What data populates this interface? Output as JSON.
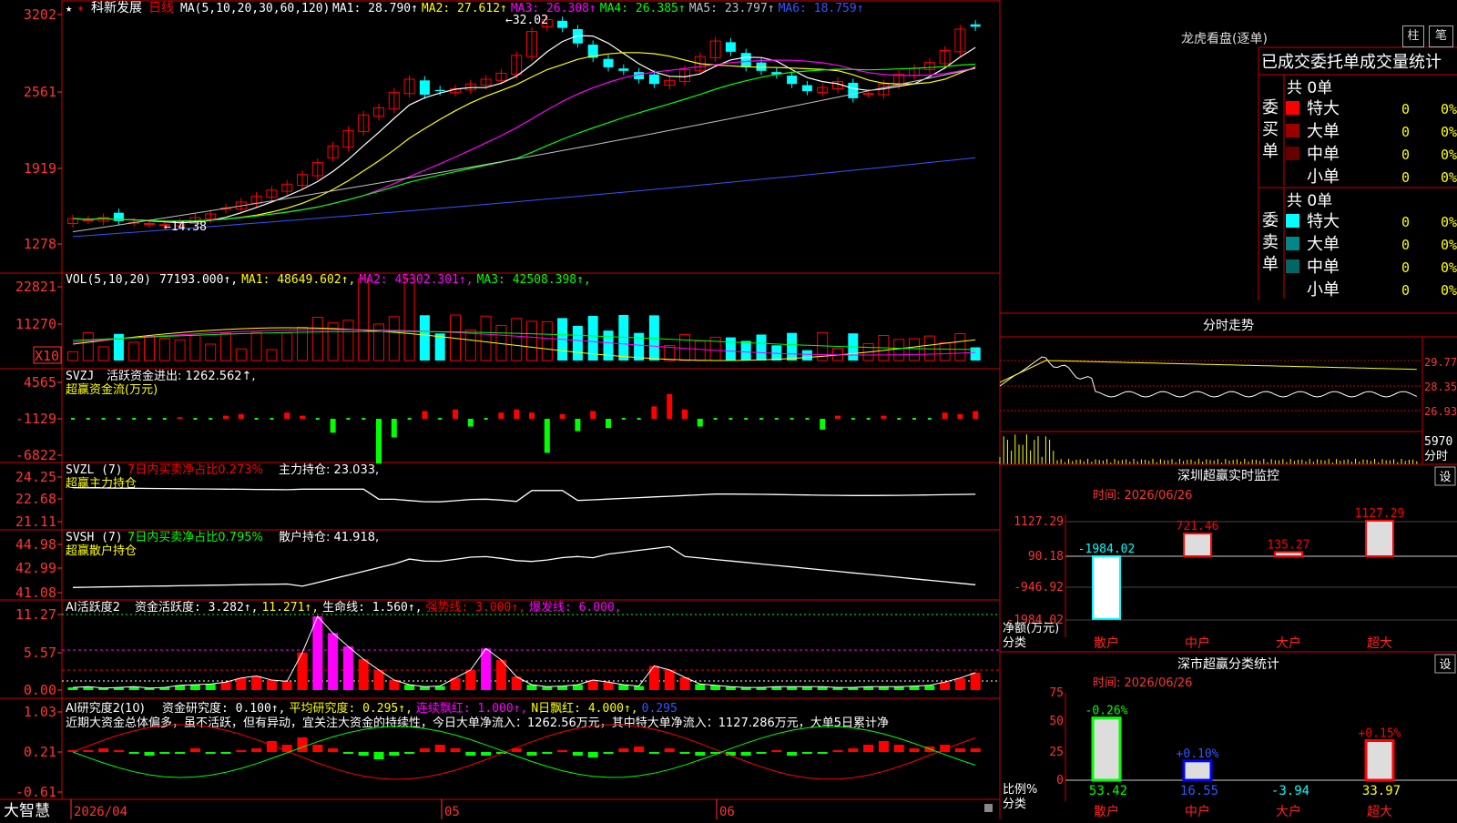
{
  "app": {
    "logo": "大智慧"
  },
  "main_chart": {
    "stock_name": "科新发展",
    "period": "日线",
    "ma_header": "MA(5,10,20,30,60,120)",
    "ma_labels": [
      {
        "text": "MA1: 28.790",
        "color": "#ffffff"
      },
      {
        "text": "MA2: 27.612",
        "color": "#ffff00"
      },
      {
        "text": "MA3: 26.308",
        "color": "#ff00ff"
      },
      {
        "text": "MA4: 26.385",
        "color": "#00ff00"
      },
      {
        "text": "MA5: 23.797",
        "color": "#c0c0c0"
      },
      {
        "text": "MA6: 18.759",
        "color": "#3355ff"
      }
    ],
    "y_ticks": [
      "3202",
      "2561",
      "1919",
      "1278"
    ],
    "high_label": "32.02",
    "low_label": "14.38"
  },
  "volume_panel": {
    "header": "VOL(5,10,20)",
    "value": "77193.000",
    "ma_labels": [
      {
        "text": "MA1: 48649.602",
        "color": "#ffff00"
      },
      {
        "text": "MA2: 45302.301",
        "color": "#ff00ff"
      },
      {
        "text": "MA3: 42508.398",
        "color": "#00ff00"
      }
    ],
    "y_ticks": [
      "22821",
      "11270"
    ],
    "unit": "X10"
  },
  "svzj_panel": {
    "header": "SVZJ",
    "label": "活跃资金进出: 1262.562",
    "sub_label": "超赢资金流(万元)",
    "y_ticks": [
      "4565",
      "-1129",
      "-6822"
    ]
  },
  "svzl_panel": {
    "header": "SVZL (7)",
    "ratio_label": "7日内买卖净占比0.273%",
    "holding_label": "主力持仓: 23.033",
    "sub_label": "超赢主力持仓",
    "y_ticks": [
      "24.25",
      "22.68",
      "21.11"
    ]
  },
  "svsh_panel": {
    "header": "SVSH (7)",
    "ratio_label": "7日内买卖净占比0.795%",
    "holding_label": "散户持仓: 41.918",
    "sub_label": "超赢散户持仓",
    "y_ticks": [
      "44.98",
      "42.99",
      "41.08"
    ]
  },
  "ai_active_panel": {
    "header": "AI活跃度2",
    "items": [
      {
        "text": "资金活跃度: 3.282",
        "color": "#ffffff"
      },
      {
        "text": "11.271",
        "color": "#ffff00"
      },
      {
        "text": "生命线: 1.560",
        "color": "#ffffff"
      },
      {
        "text": "强势线: 3.000",
        "color": "#ff0000"
      },
      {
        "text": "爆发线: 6.000",
        "color": "#ff00ff"
      }
    ],
    "y_ticks": [
      "11.27",
      "5.57",
      "0.00"
    ]
  },
  "ai_research_panel": {
    "header": "AI研究度2(10)",
    "items": [
      {
        "text": "资金研究度: 0.100",
        "color": "#ffffff"
      },
      {
        "text": "平均研究度: 0.295",
        "color": "#ffff00"
      },
      {
        "text": "连续飘红: 1.000",
        "color": "#ff00ff"
      },
      {
        "text": "N日飘红: 4.000",
        "color": "#ffff00"
      },
      {
        "text": "0.295",
        "color": "#3355ff"
      }
    ],
    "commentary": "近期大资金总体偏多，虽不活跃，但有异动，宜关注大资金的持续性，今日大单净流入：1262.56万元，其中特大单净流入：1127.286万元，大单5日累计净",
    "y_ticks": [
      "1.03",
      "0.21",
      "-0.61"
    ]
  },
  "x_axis": {
    "labels": [
      "2026/04",
      "05",
      "06"
    ]
  },
  "dragon_panel": {
    "title": "龙虎看盘(逐单)",
    "btn_bar": "柱",
    "btn_pen": "笔",
    "header": "已成交委托单成交量统计",
    "buy_side": {
      "label": "委买单",
      "total": "共 0单",
      "rows": [
        {
          "name": "特大",
          "count": "0",
          "pct": "0%",
          "color": "#ff0000"
        },
        {
          "name": "大单",
          "count": "0",
          "pct": "0%",
          "color": "#990000"
        },
        {
          "name": "中单",
          "count": "0",
          "pct": "0%",
          "color": "#660000"
        },
        {
          "name": "小单",
          "count": "0",
          "pct": "0%",
          "color": ""
        }
      ]
    },
    "sell_side": {
      "label": "委卖单",
      "total": "共 0单",
      "rows": [
        {
          "name": "特大",
          "count": "0",
          "pct": "0%",
          "color": "#00ffff"
        },
        {
          "name": "大单",
          "count": "0",
          "pct": "0%",
          "color": "#008888"
        },
        {
          "name": "中单",
          "count": "0",
          "pct": "0%",
          "color": "#006666"
        },
        {
          "name": "小单",
          "count": "0",
          "pct": "0%",
          "color": ""
        }
      ]
    }
  },
  "intraday_panel": {
    "title": "分时走势",
    "y_ticks": [
      "29.77",
      "28.35",
      "26.93"
    ],
    "vol_tick": "5970",
    "vol_unit": "分时"
  },
  "sz_monitor_panel": {
    "title": "深圳超赢实时监控",
    "btn": "设",
    "time_label": "时间: 2026/06/26",
    "y_ticks": [
      "1127.29",
      "90.18",
      "-946.92",
      "-1984.02"
    ],
    "axis_label": "净额(万元)",
    "cat_label": "分类",
    "chart_data": {
      "type": "bar",
      "categories": [
        "散户",
        "中户",
        "大户",
        "超大"
      ],
      "values": [
        -1984.02,
        721.46,
        135.27,
        1127.29
      ],
      "ylim": [
        -1984.02,
        1127.29
      ]
    }
  },
  "sz_class_panel": {
    "title": "深市超赢分类统计",
    "btn": "设",
    "time_label": "时间: 2026/06/26",
    "y_ticks": [
      "75",
      "50",
      "25",
      "0"
    ],
    "axis_label": "比例%",
    "cat_label": "分类",
    "chart_data": {
      "type": "bar",
      "categories": [
        "散户",
        "中户",
        "大户",
        "超大"
      ],
      "values": [
        53.42,
        16.55,
        -3.94,
        33.97
      ],
      "changes": [
        "-0.26%",
        "+0.10%",
        "",
        "+0.15%"
      ],
      "ylim": [
        0,
        75
      ]
    }
  },
  "colors": {
    "up": "#ff0000",
    "down": "#00ffff",
    "grid": "#cc0000",
    "axis_text": "#ff3333",
    "label_yellow": "#ffff00",
    "category_red": "#ff2222"
  }
}
